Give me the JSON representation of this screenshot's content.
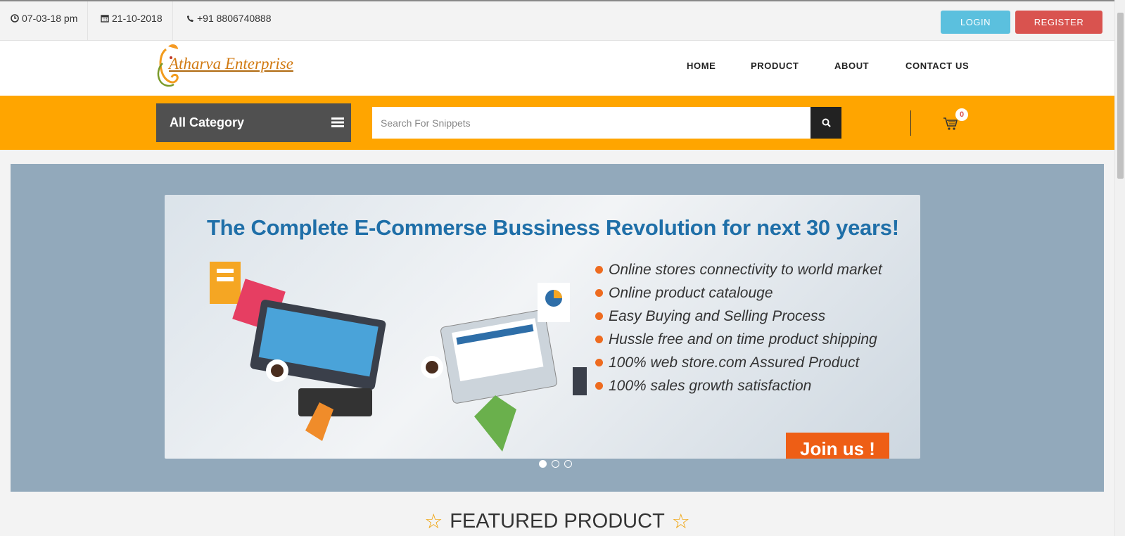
{
  "topbar": {
    "time": "07-03-18 pm",
    "date": "21-10-2018",
    "phone": "+91 8806740888",
    "login_label": "LOGIN",
    "register_label": "REGISTER"
  },
  "brand": {
    "name": "Atharva Enterprise"
  },
  "nav": [
    "HOME",
    "PRODUCT",
    "ABOUT",
    "CONTACT US"
  ],
  "category": {
    "label": "All Category"
  },
  "search": {
    "placeholder": "Search For Snippets"
  },
  "cart": {
    "count": "0"
  },
  "banner": {
    "title": "The Complete E-Commerse Bussiness Revolution for next 30 years!",
    "features": [
      "Online stores connectivity to world market",
      "Online product catalouge",
      "Easy Buying and Selling Process",
      "Hussle free and on time product shipping",
      "100% web store.com Assured Product",
      "100% sales growth satisfaction"
    ],
    "cta": "Join us !",
    "active_slide": 1
  },
  "featured": {
    "title": "FEATURED PRODUCT"
  },
  "colors": {
    "orange": "#ffa500",
    "login": "#5bc0de",
    "register": "#d9534f",
    "banner_bg": "#92a9bb"
  }
}
